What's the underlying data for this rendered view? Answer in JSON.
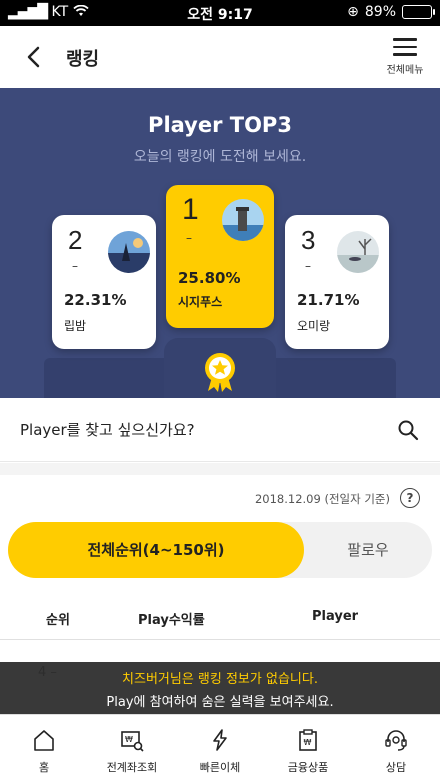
{
  "status_bar": {
    "carrier": "KT",
    "time": "오전 9:17",
    "battery": "89%",
    "battery_level": 0.89
  },
  "header": {
    "title": "랭킹",
    "menu_label": "전체메뉴"
  },
  "hero": {
    "title": "Player TOP3",
    "subtitle": "오늘의 랭킹에 도전해 보세요.",
    "top3": [
      {
        "rank": "1",
        "change": "–",
        "return_rate": "25.80%",
        "name": "시지푸스"
      },
      {
        "rank": "2",
        "change": "–",
        "return_rate": "22.31%",
        "name": "립밤"
      },
      {
        "rank": "3",
        "change": "–",
        "return_rate": "21.71%",
        "name": "오미랑"
      }
    ]
  },
  "search": {
    "placeholder": "Player를 찾고 싶으신가요?"
  },
  "ranking": {
    "base_date": "2018.12.09 (전일자 기준)",
    "tabs": [
      {
        "label": "전체순위(4~150위)",
        "active": true
      },
      {
        "label": "팔로우",
        "active": false
      }
    ],
    "columns": [
      "순위",
      "Play수익률",
      "Player"
    ],
    "first_row_rank": "4 –"
  },
  "toast": {
    "line1": "치즈버거님은 랭킹 정보가 없습니다.",
    "line2": "Play에 참여하여 숨은 실력을 보여주세요."
  },
  "bottom_nav": [
    {
      "label": "홈",
      "icon": "home-icon"
    },
    {
      "label": "전계좌조회",
      "icon": "account-search-icon"
    },
    {
      "label": "빠른이체",
      "icon": "lightning-icon"
    },
    {
      "label": "금융상품",
      "icon": "product-icon"
    },
    {
      "label": "상담",
      "icon": "headset-icon"
    }
  ],
  "colors": {
    "accent": "#ffcc00",
    "hero_bg": "#3d4a7a",
    "battery": "#45d957"
  }
}
